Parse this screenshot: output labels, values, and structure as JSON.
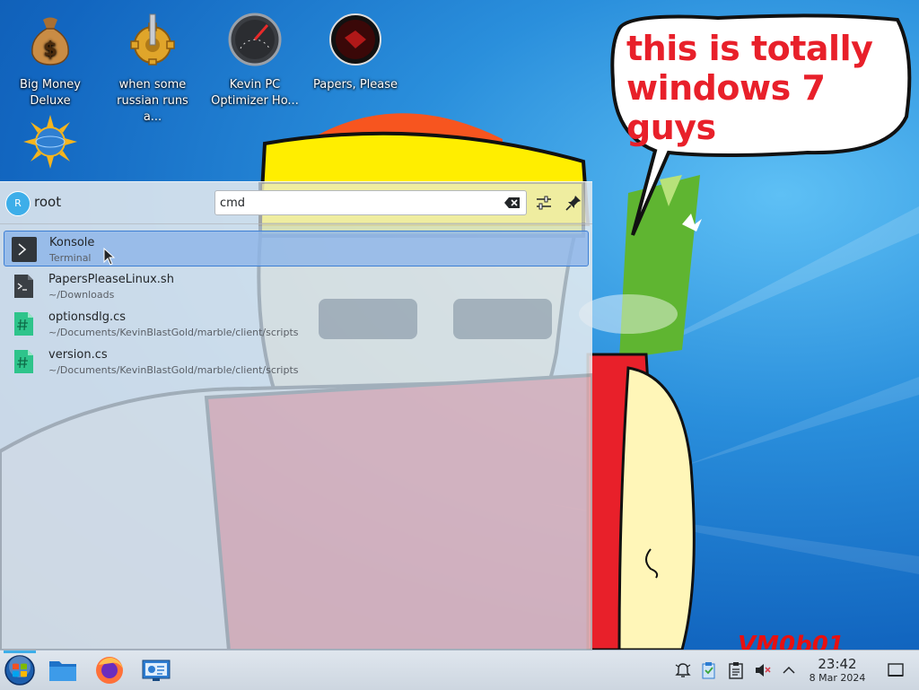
{
  "desktop": {
    "icons": [
      {
        "label": "Big Money\nDeluxe",
        "icon": "money-bag-icon"
      },
      {
        "label": "when some\nrussian runs a...",
        "icon": "gear-icon"
      },
      {
        "label": "Kevin PC\nOptimizer Ho...",
        "icon": "speedometer-icon"
      },
      {
        "label": "Papers, Please",
        "icon": "papers-please-icon"
      },
      {
        "label": "",
        "icon": "sun-globe-icon"
      }
    ],
    "speech_bubble": {
      "line1": "this is totally",
      "line2": "windows 7 guys"
    },
    "watermark": "VM0b01",
    "colors": {
      "bubble_text": "#e8202a",
      "desktop_blue": "#1266c0"
    }
  },
  "launcher": {
    "user": {
      "initial": "R",
      "name": "root"
    },
    "search": {
      "value": "cmd",
      "placeholder": ""
    },
    "results": [
      {
        "title": "Konsole",
        "subtitle": "Terminal",
        "icon": "terminal-icon",
        "selected": true
      },
      {
        "title": "PapersPleaseLinux.sh",
        "subtitle": "~/Downloads",
        "icon": "script-file-icon",
        "selected": false
      },
      {
        "title": "optionsdlg.cs",
        "subtitle": "~/Documents/KevinBlastGold/marble/client/scripts",
        "icon": "csharp-file-icon",
        "selected": false
      },
      {
        "title": "version.cs",
        "subtitle": "~/Documents/KevinBlastGold/marble/client/scripts",
        "icon": "csharp-file-icon",
        "selected": false
      }
    ]
  },
  "taskbar": {
    "apps": [
      "start-orb-icon",
      "file-manager-icon",
      "firefox-icon",
      "system-settings-icon"
    ],
    "tray": [
      "notifications-icon",
      "clipboard-icon",
      "clipboard-history-icon",
      "volume-muted-icon",
      "expand-tray-icon"
    ],
    "clock": {
      "time": "23:42",
      "date": "8 Mar 2024"
    },
    "show_desktop": "show-desktop-icon"
  }
}
